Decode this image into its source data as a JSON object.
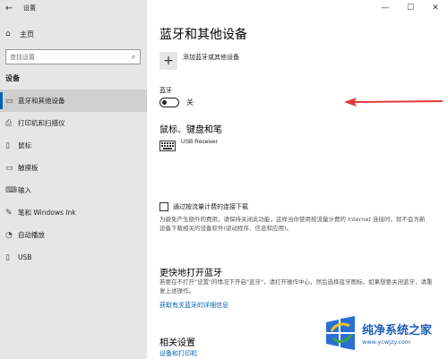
{
  "window": {
    "app_title": "设置",
    "controls": [
      "—",
      "☐",
      "✕"
    ]
  },
  "sidebar": {
    "home_label": "主页",
    "search_placeholder": "查找设置",
    "section_label": "设备",
    "items": [
      {
        "label": "蓝牙和其他设备",
        "icon": "bluetooth-device-icon",
        "selected": true
      },
      {
        "label": "打印机和扫描仪",
        "icon": "printer-icon",
        "selected": false
      },
      {
        "label": "鼠标",
        "icon": "mouse-icon",
        "selected": false
      },
      {
        "label": "触摸板",
        "icon": "touchpad-icon",
        "selected": false
      },
      {
        "label": "输入",
        "icon": "keyboard-icon",
        "selected": false
      },
      {
        "label": "笔和 Windows Ink",
        "icon": "pen-icon",
        "selected": false
      },
      {
        "label": "自动播放",
        "icon": "autoplay-icon",
        "selected": false
      },
      {
        "label": "USB",
        "icon": "usb-icon",
        "selected": false
      }
    ]
  },
  "main": {
    "page_title": "蓝牙和其他设备",
    "add_device_label": "添加蓝牙或其他设备",
    "bluetooth_label": "蓝牙",
    "bluetooth_state": "关",
    "bluetooth_on": false,
    "section_mouse_keyboard_pen": "鼠标、键盘和笔",
    "device_name": "USB Receiver",
    "metered_label": "通过按流量计费的连接下载",
    "metered_checked": false,
    "metered_desc": "为避免产生额外的费用，请保持关闭此功能，这样当你使用按流量计费的 Internet 连接时，就不会为新设备下载相关的设备软件(驱动程序、信息和应用)。",
    "faster_title": "更快地打开蓝牙",
    "faster_desc": "若要在不打开\"设置\"的情况下开启\"蓝牙\"，请打开操作中心，然后选择蓝牙图标。如果想要关闭蓝牙，请重复上述操作。",
    "faster_link": "获取有关蓝牙的详细信息",
    "related_title": "相关设置",
    "related_link": "设备和打印机"
  },
  "watermark": {
    "name": "纯净系统之家",
    "url": "www.ycwjzy.com"
  },
  "colors": {
    "accent": "#0063b1",
    "sidebar_bg": "#e6e6e6",
    "annotation_arrow": "#e03a3a"
  }
}
